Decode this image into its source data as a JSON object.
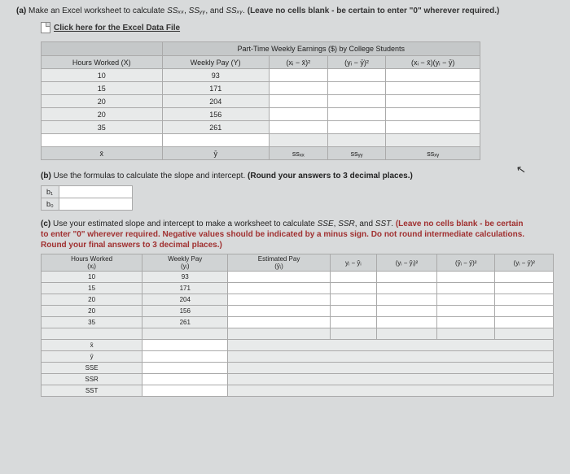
{
  "partA": {
    "prefix": "(a) ",
    "text1": "Make an Excel worksheet to calculate ",
    "ssxx": "SSₓₓ",
    "comma1": ", ",
    "ssyy": "SSᵧᵧ",
    "comma2": ", and ",
    "ssxy": "SSₓᵧ",
    "text2": ". ",
    "bold": "(Leave no cells blank - be certain to enter \"0\" wherever required.)"
  },
  "link": "Click here for the Excel Data File",
  "tableA": {
    "title": "Part-Time Weekly Earnings ($) by College Students",
    "h1": "Hours Worked (X)",
    "h2": "Weekly Pay (Y)",
    "h3": "(xᵢ − x̄)²",
    "h4": "(yᵢ − ȳ)²",
    "h5": "(xᵢ − x̄)(yᵢ − ȳ)",
    "rows": [
      {
        "x": "10",
        "y": "93"
      },
      {
        "x": "15",
        "y": "171"
      },
      {
        "x": "20",
        "y": "204"
      },
      {
        "x": "20",
        "y": "156"
      },
      {
        "x": "35",
        "y": "261"
      }
    ],
    "sum": {
      "c1": "x̄",
      "c2": "ȳ",
      "c3": "ssₓₓ",
      "c4": "ssᵧᵧ",
      "c5": "ssₓᵧ"
    }
  },
  "partB": {
    "prefix": "(b) ",
    "text": "Use the formulas to calculate the slope and intercept. ",
    "bold": "(Round your answers to 3 decimal places.)",
    "b1": "b₁",
    "b0": "b₀"
  },
  "partC": {
    "prefix": "(c) ",
    "text1": "Use your estimated slope and intercept to make a worksheet to calculate ",
    "sse": "SSE",
    "c1": ", ",
    "ssr": "SSR",
    "c2": ", and ",
    "sst": "SST",
    "text2": ". ",
    "bold": "(Leave no cells blank - be certain to enter \"0\" wherever required. Negative values should be indicated by a minus sign. Do not round intermediate calculations. Round your final answers to 3 decimal places.)"
  },
  "tableC": {
    "h1a": "Hours Worked",
    "h1b": "(xᵢ)",
    "h2a": "Weekly Pay",
    "h2b": "(yᵢ)",
    "h3a": "Estimated Pay",
    "h3b": "(ŷᵢ)",
    "h4": "yᵢ − ŷᵢ",
    "h5": "(yᵢ − ŷᵢ)²",
    "h6": "(ŷᵢ − ȳ)²",
    "h7": "(yᵢ − ȳ)²",
    "rows": [
      {
        "x": "10",
        "y": "93"
      },
      {
        "x": "15",
        "y": "171"
      },
      {
        "x": "20",
        "y": "204"
      },
      {
        "x": "20",
        "y": "156"
      },
      {
        "x": "35",
        "y": "261"
      }
    ],
    "s1": "x̄",
    "s2": "ȳ",
    "s3": "SSE",
    "s4": "SSR",
    "s5": "SST"
  }
}
